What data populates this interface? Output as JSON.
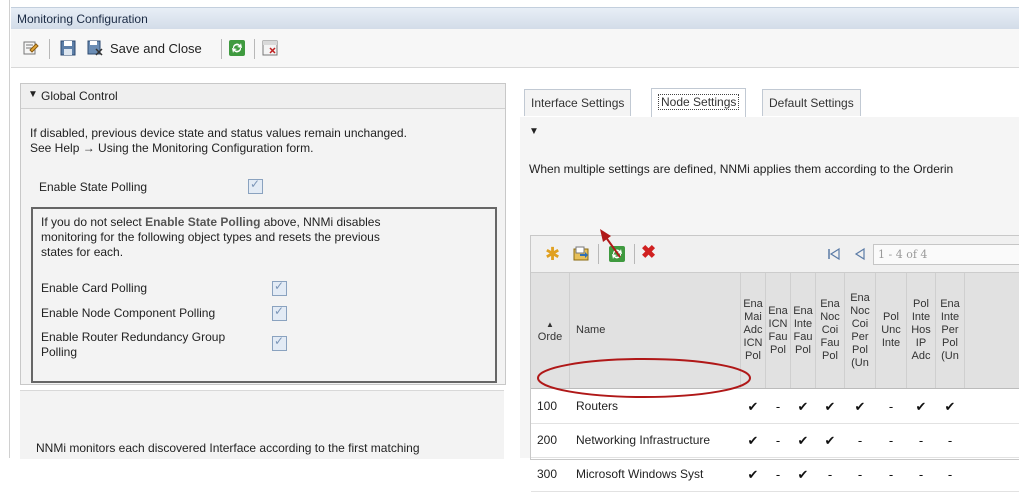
{
  "window": {
    "title": "Monitoring Configuration"
  },
  "toolbar": {
    "save_close_label": "Save and Close"
  },
  "global_control": {
    "header": "Global Control",
    "info_line1": "If disabled, previous device state and status values remain unchanged.",
    "info_line2": "See Help → Using the Monitoring Configuration form.",
    "enable_state_polling_label": "Enable State Polling",
    "box_line1_prefix": "If you do not select ",
    "box_line1_bold": "Enable State Polling",
    "box_line1_suffix": " above, NNMi disables",
    "box_line2": "monitoring for the following object types and resets the previous",
    "box_line3": "states for each.",
    "card_polling_label": "Enable Card Polling",
    "node_component_label": "Enable Node Component Polling",
    "router_redundancy_line1": "Enable Router Redundancy Group",
    "router_redundancy_line2": "Polling"
  },
  "lower_left": {
    "text": "NNMi monitors each discovered Interface according to the first matching"
  },
  "tabs": [
    {
      "label": "Interface Settings"
    },
    {
      "label": "Node Settings"
    },
    {
      "label": "Default Settings"
    }
  ],
  "right_panel": {
    "info": "When multiple settings are defined, NNMi applies them according to the Orderin",
    "pager_text": "1 - 4 of 4"
  },
  "table": {
    "headers": {
      "order": "Orde",
      "name": "Name",
      "c1": [
        "Ena",
        "Mai",
        "Adc",
        "ICN",
        "Pol"
      ],
      "c2": [
        "Ena",
        "ICN",
        "Fau",
        "Pol"
      ],
      "c3": [
        "Ena",
        "Inte",
        "Fau",
        "Pol"
      ],
      "c4": [
        "Ena",
        "Noc",
        "Coi",
        "Fau",
        "Pol"
      ],
      "c5": [
        "Ena",
        "Noc",
        "Coi",
        "Per",
        "Pol",
        "(Un"
      ],
      "c6": [
        "Pol",
        "Unc",
        "Inte"
      ],
      "c7": [
        "Pol",
        "Inte",
        "Hos",
        "IP",
        "Adc"
      ],
      "c8": [
        "Ena",
        "Inte",
        "Per",
        "Pol",
        "(Un"
      ]
    },
    "rows": [
      {
        "order": "100",
        "name": "Routers",
        "cells": [
          "✔",
          "-",
          "✔",
          "✔",
          "✔",
          "-",
          "✔",
          "✔"
        ]
      },
      {
        "order": "200",
        "name": "Networking Infrastructure",
        "cells": [
          "✔",
          "-",
          "✔",
          "✔",
          "-",
          "-",
          "-",
          "-"
        ]
      },
      {
        "order": "300",
        "name": "Microsoft Windows Syst",
        "cells": [
          "✔",
          "-",
          "✔",
          "-",
          "-",
          "-",
          "-",
          "-"
        ]
      }
    ]
  },
  "colors": {
    "title_text": "#1a2a44",
    "annotation": "#b01818"
  }
}
